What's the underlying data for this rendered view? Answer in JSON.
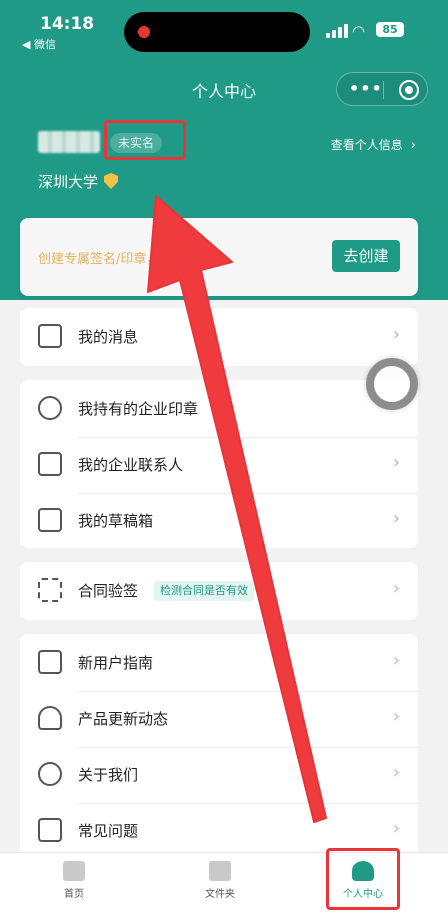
{
  "status_bar": {
    "time": "14:18",
    "back_label": "◀ 微信",
    "battery": "85"
  },
  "nav": {
    "title": "个人中心",
    "more_icon": "more-dots-icon",
    "close_icon": "target-circle-icon"
  },
  "profile": {
    "verify_badge": "未实名",
    "view_info": "查看个人信息",
    "school": "深圳大学",
    "school_badge_icon": "verified-shield-icon"
  },
  "promo": {
    "text": "创建专属签名/印章，签署更方便",
    "button": "去创建"
  },
  "groups": [
    {
      "items": [
        {
          "name": "messages",
          "icon": "message-icon",
          "label": "我的消息"
        }
      ]
    },
    {
      "items": [
        {
          "name": "enterprise-seals",
          "icon": "seal-icon",
          "label": "我持有的企业印章"
        },
        {
          "name": "enterprise-contacts",
          "icon": "contacts-icon",
          "label": "我的企业联系人"
        },
        {
          "name": "drafts",
          "icon": "draft-icon",
          "label": "我的草稿箱"
        }
      ]
    },
    {
      "items": [
        {
          "name": "contract-verify",
          "icon": "scan-verify-icon",
          "label": "合同验签",
          "tag": "检测合同是否有效"
        }
      ]
    },
    {
      "items": [
        {
          "name": "new-user-guide",
          "icon": "guide-icon",
          "label": "新用户指南"
        },
        {
          "name": "product-updates",
          "icon": "rocket-icon",
          "label": "产品更新动态"
        },
        {
          "name": "about-us",
          "icon": "about-icon",
          "label": "关于我们"
        },
        {
          "name": "faq",
          "icon": "faq-icon",
          "label": "常见问题"
        }
      ]
    }
  ],
  "tabbar": {
    "home": "首页",
    "files": "文件夹",
    "profile": "个人中心"
  },
  "colors": {
    "brand": "#1f9a86",
    "annotation": "#e8353a",
    "promo_text": "#e2b45a"
  }
}
